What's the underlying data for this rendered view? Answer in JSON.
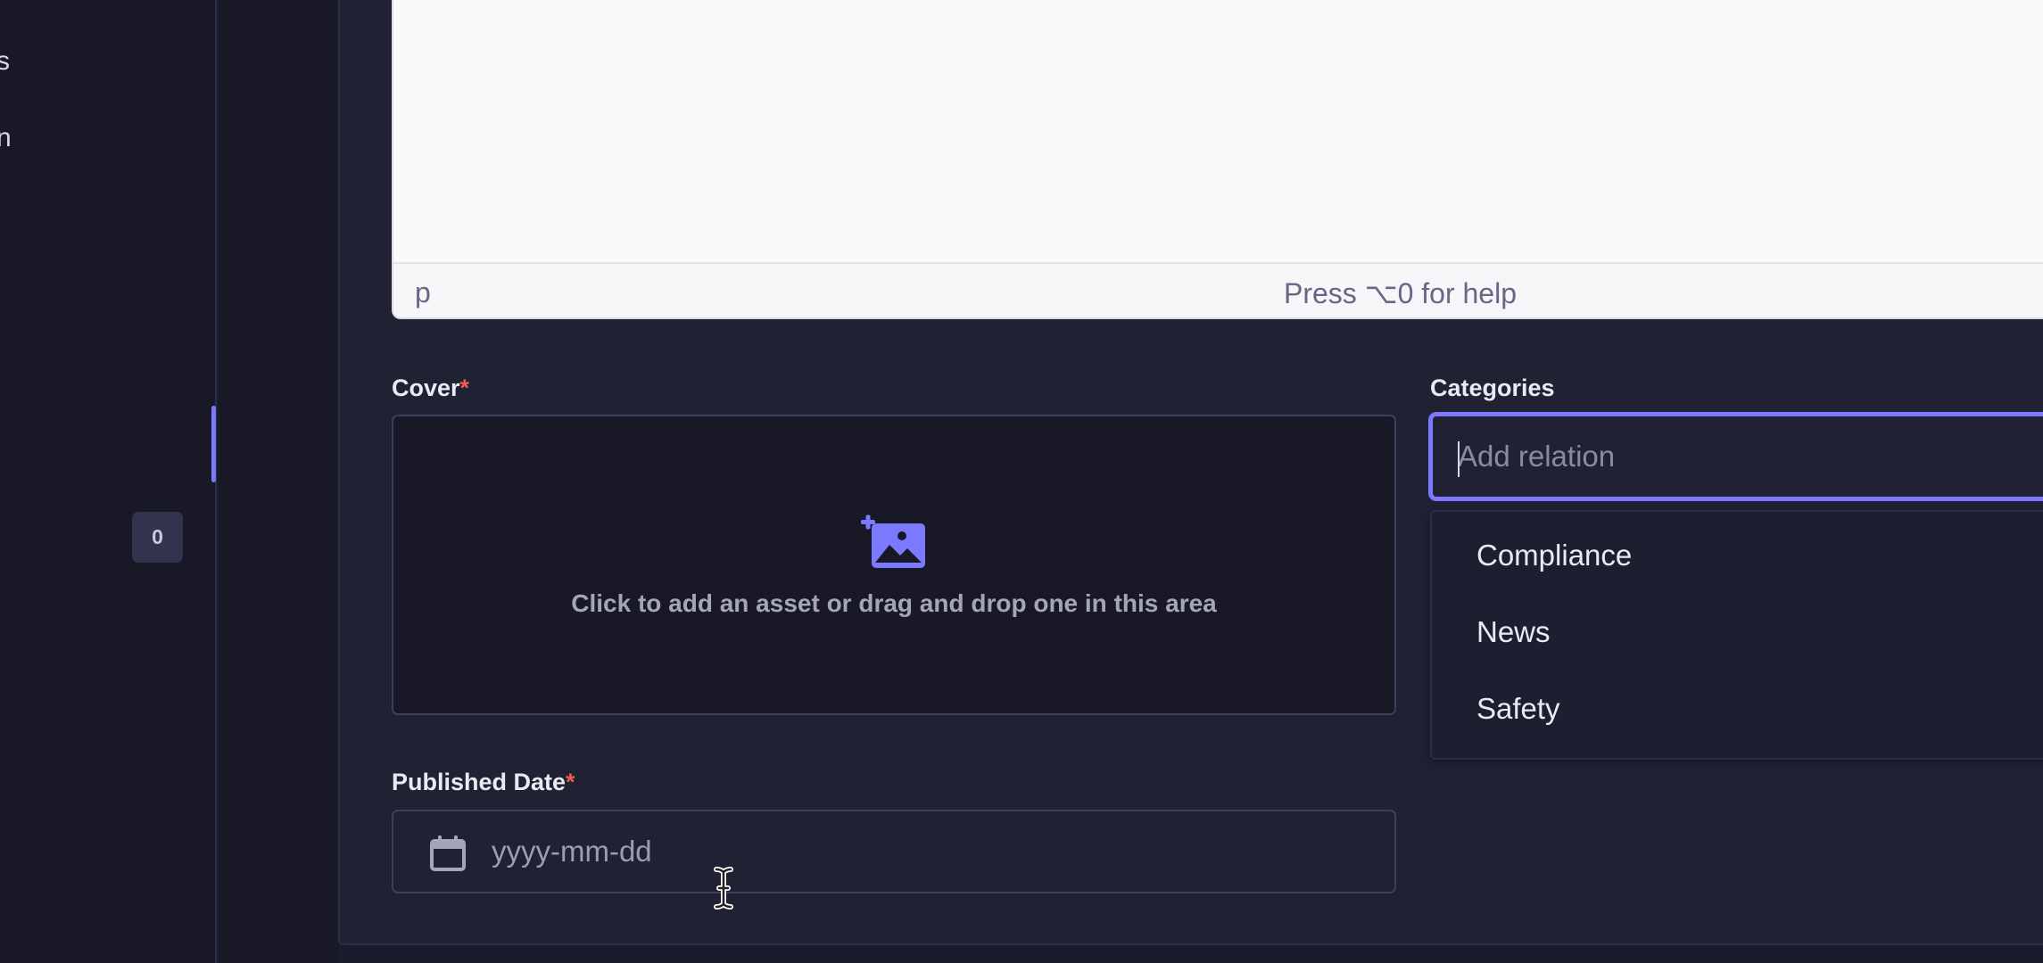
{
  "left_nav": {
    "fragments": [
      "s",
      "n"
    ],
    "badge": "0"
  },
  "editor": {
    "status_tag": "p",
    "help_text": "Press ⌥0 for help"
  },
  "cover": {
    "label": "Cover",
    "required_mark": "*",
    "dropzone_text": "Click to add an asset or drag and drop one in this area",
    "icon": "add-image-icon"
  },
  "published_date": {
    "label": "Published Date",
    "required_mark": "*",
    "placeholder": "yyyy-mm-dd",
    "icon": "calendar-icon"
  },
  "categories": {
    "label": "Categories",
    "placeholder": "Add relation",
    "options": [
      "Compliance",
      "News",
      "Safety"
    ]
  },
  "colors": {
    "accent": "#7b79ff",
    "background": "#1a1b2b",
    "panel": "#202133",
    "required": "#ee5e52"
  }
}
